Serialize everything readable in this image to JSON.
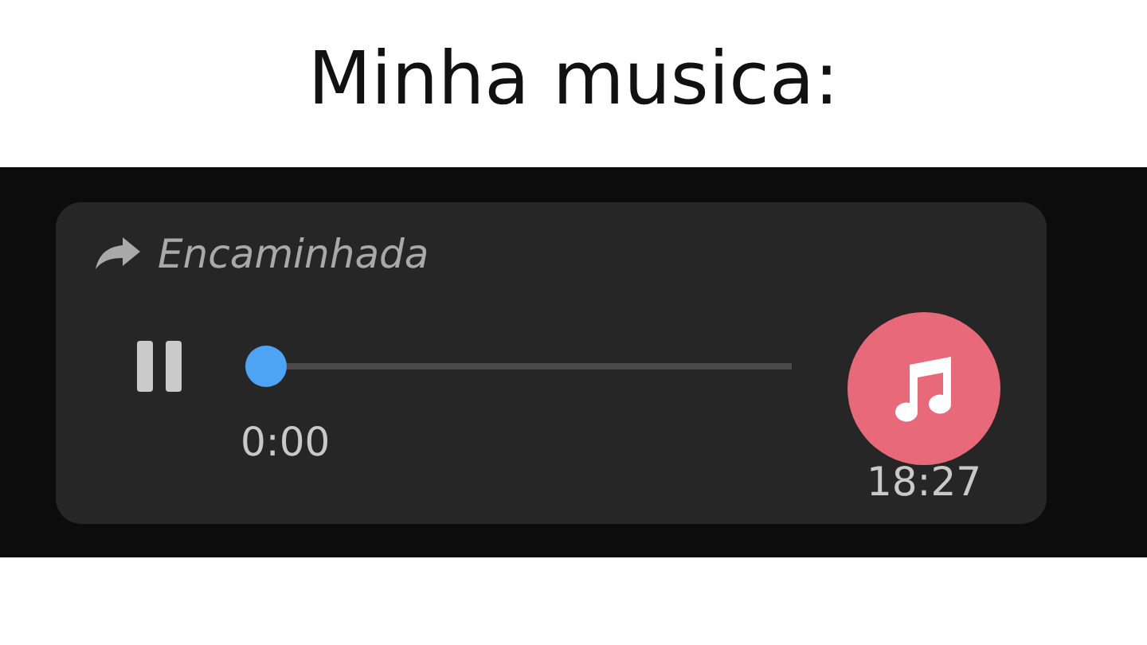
{
  "title": "Minha musica:",
  "message": {
    "forwarded_label": "Encaminhada",
    "playing": true,
    "level": 0,
    "elapsed": "0:00",
    "duration": "18:27"
  }
}
